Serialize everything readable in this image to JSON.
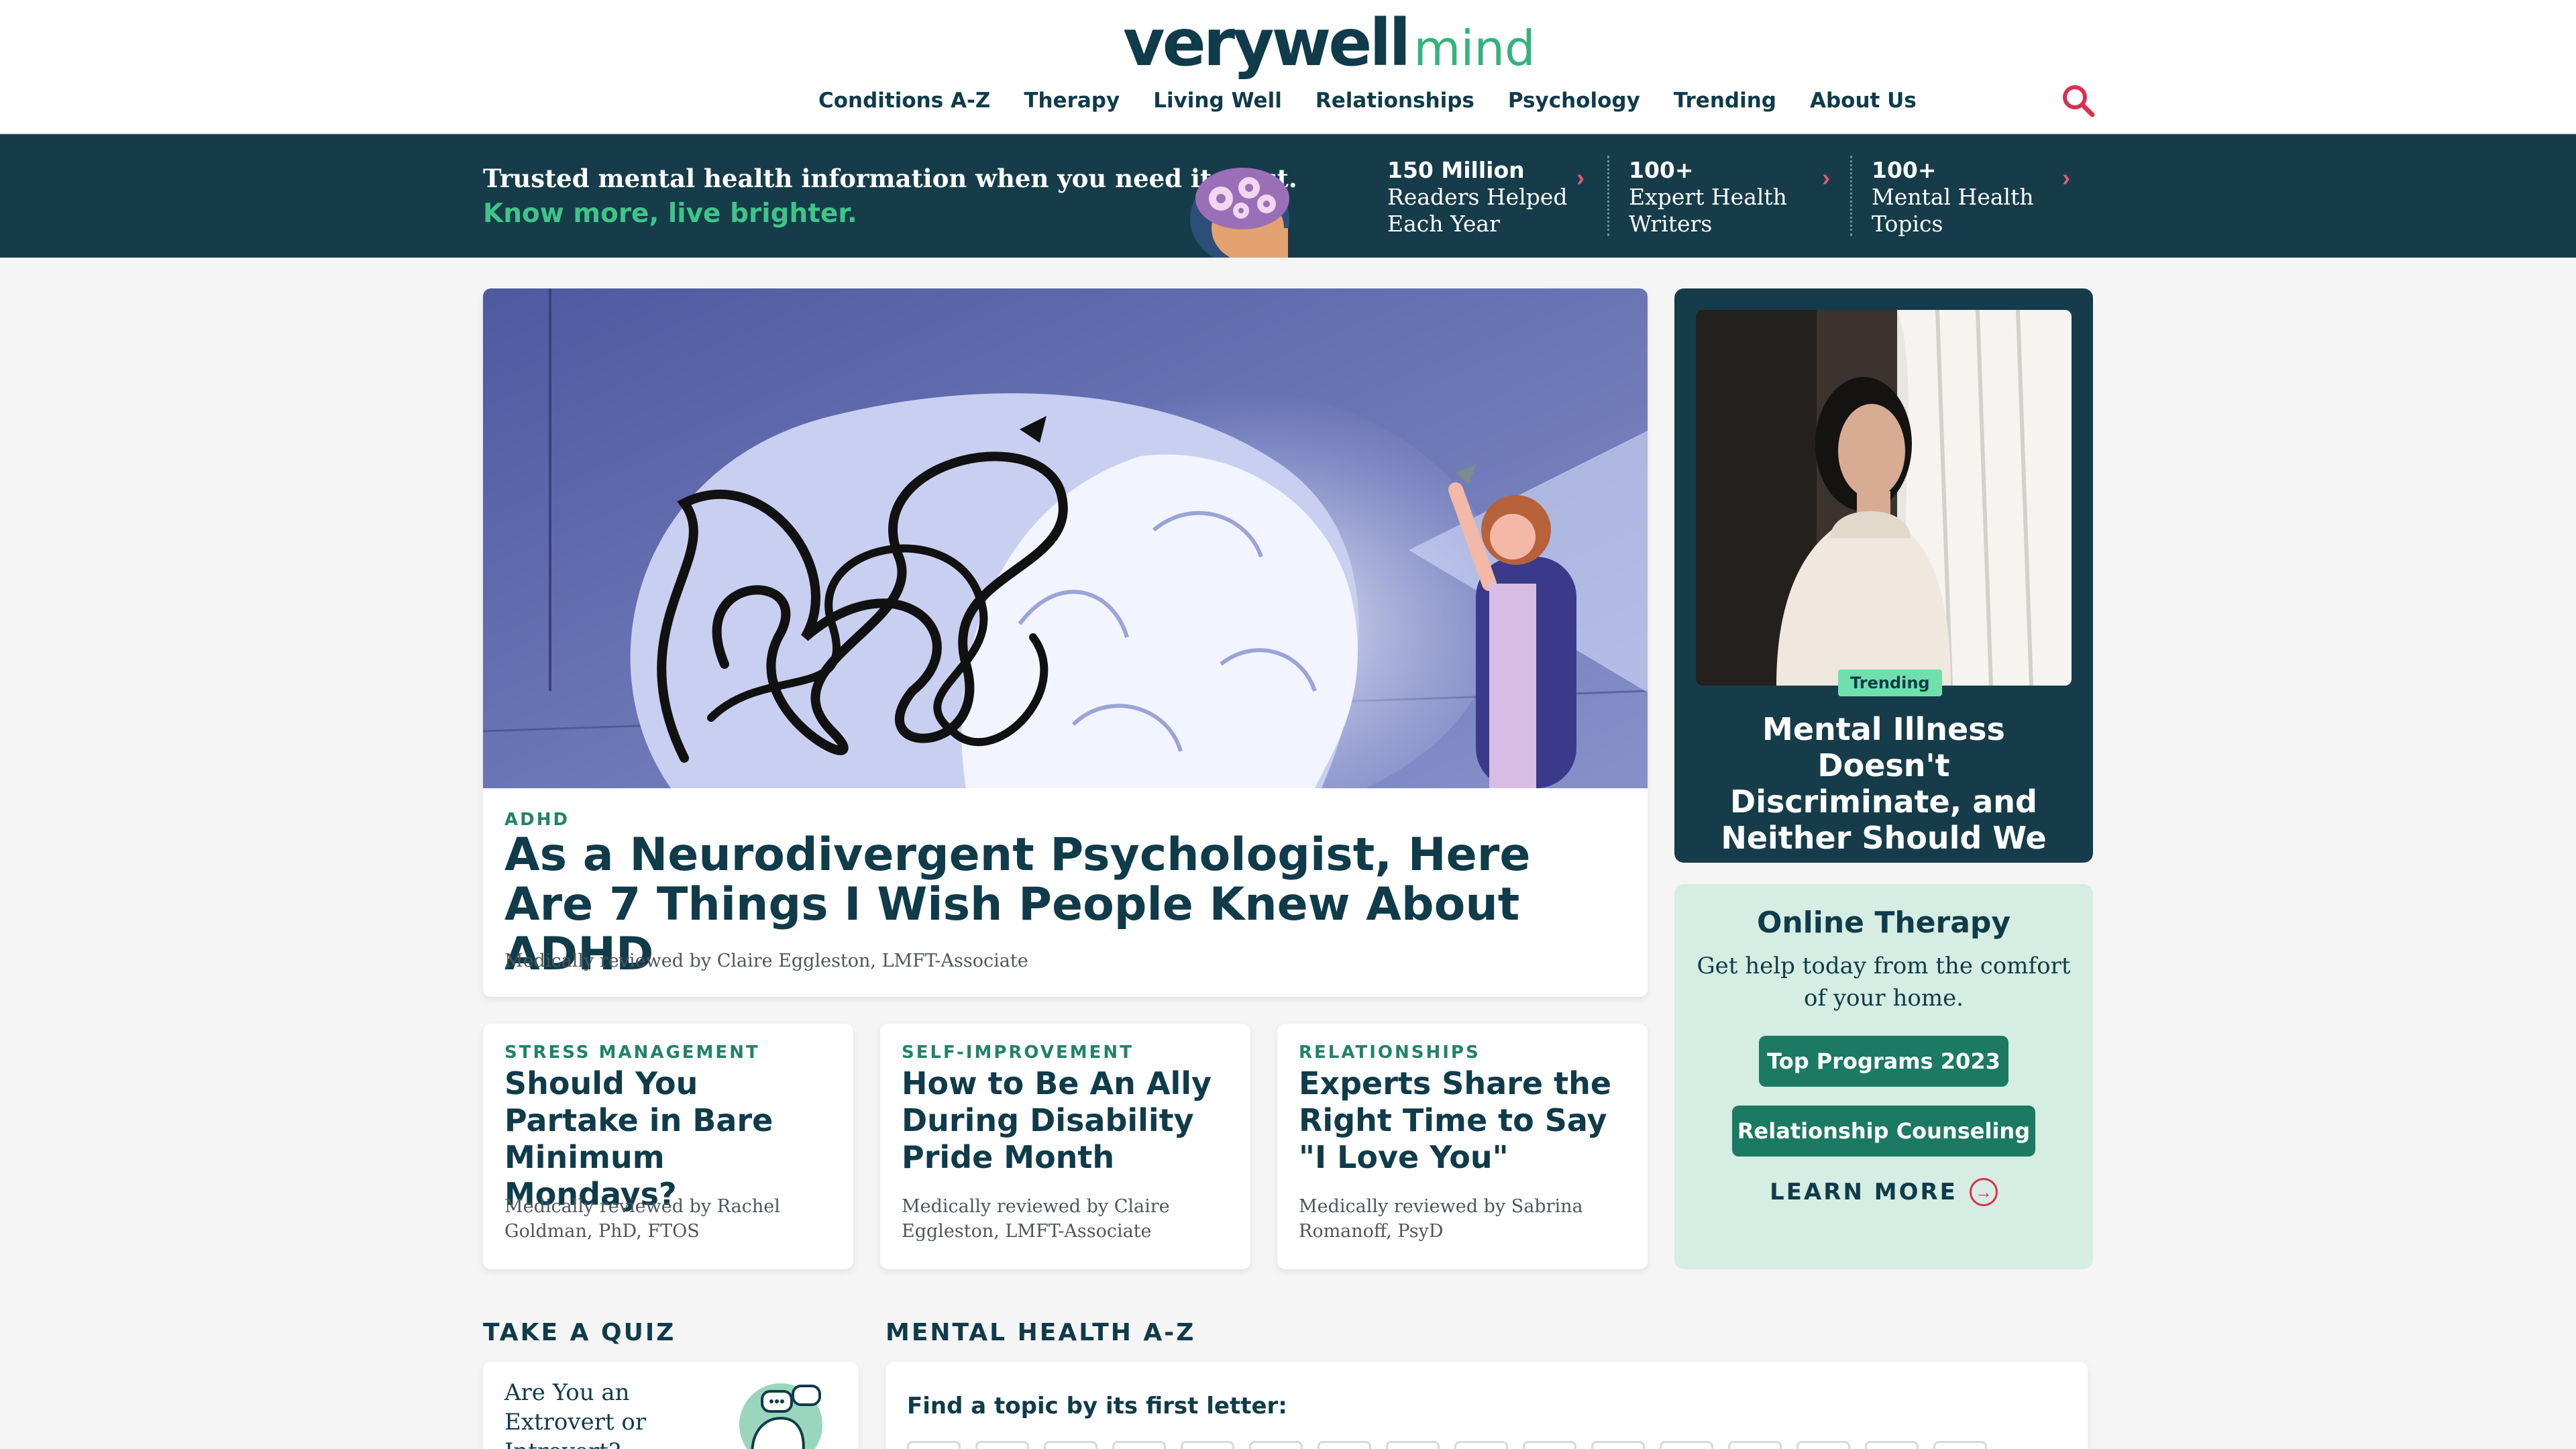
{
  "header": {
    "logo_main": "verywell",
    "logo_accent": "mind",
    "nav": [
      "Conditions A-Z",
      "Therapy",
      "Living Well",
      "Relationships",
      "Psychology",
      "Trending",
      "About Us"
    ]
  },
  "banner": {
    "line1": "Trusted mental health information when you need it most.",
    "line2": "Know more, live brighter.",
    "stats": [
      {
        "bold": "150 Million",
        "lines": [
          "Readers Helped",
          "Each Year"
        ]
      },
      {
        "bold": "100+",
        "lines": [
          "Expert Health",
          "Writers"
        ]
      },
      {
        "bold": "100+",
        "lines": [
          "Mental Health",
          "Topics"
        ]
      }
    ]
  },
  "hero": {
    "kicker": "ADHD",
    "title": "As a Neurodivergent Psychologist, Here Are 7 Things I Wish People Knew About ADHD",
    "byline": "Medically reviewed by Claire Eggleston, LMFT-Associate"
  },
  "articles": [
    {
      "kicker": "STRESS MANAGEMENT",
      "title": "Should You Partake in Bare Minimum Mondays?",
      "byline": "Medically reviewed by Rachel Goldman, PhD, FTOS"
    },
    {
      "kicker": "SELF-IMPROVEMENT",
      "title": "How to Be An Ally During Disability Pride Month",
      "byline": "Medically reviewed by Claire Eggleston, LMFT-Associate"
    },
    {
      "kicker": "RELATIONSHIPS",
      "title": "Experts Share the Right Time to Say \"I Love You\"",
      "byline": "Medically reviewed by Sabrina Romanoff, PsyD"
    }
  ],
  "trending": {
    "badge": "Trending",
    "title": "Mental Illness Doesn't Discriminate, and Neither Should We"
  },
  "therapy": {
    "title": "Online Therapy",
    "subtitle": "Get help today from the comfort of your home.",
    "button1": "Top Programs 2023",
    "button2": "Relationship Counseling",
    "learn_more": "LEARN MORE"
  },
  "quiz": {
    "section_title": "TAKE A QUIZ",
    "card_text": "Are You an Extrovert or Introvert?"
  },
  "az": {
    "section_title": "MENTAL HEALTH A-Z",
    "prompt": "Find a topic by its first letter:"
  },
  "colors": {
    "navy": "#0f3b4a",
    "banner": "#163c4a",
    "green_accent": "#3fc48a",
    "kicker_green": "#21826a",
    "pink_accent": "#d8304f",
    "therapy_bg": "#d5ede2"
  }
}
